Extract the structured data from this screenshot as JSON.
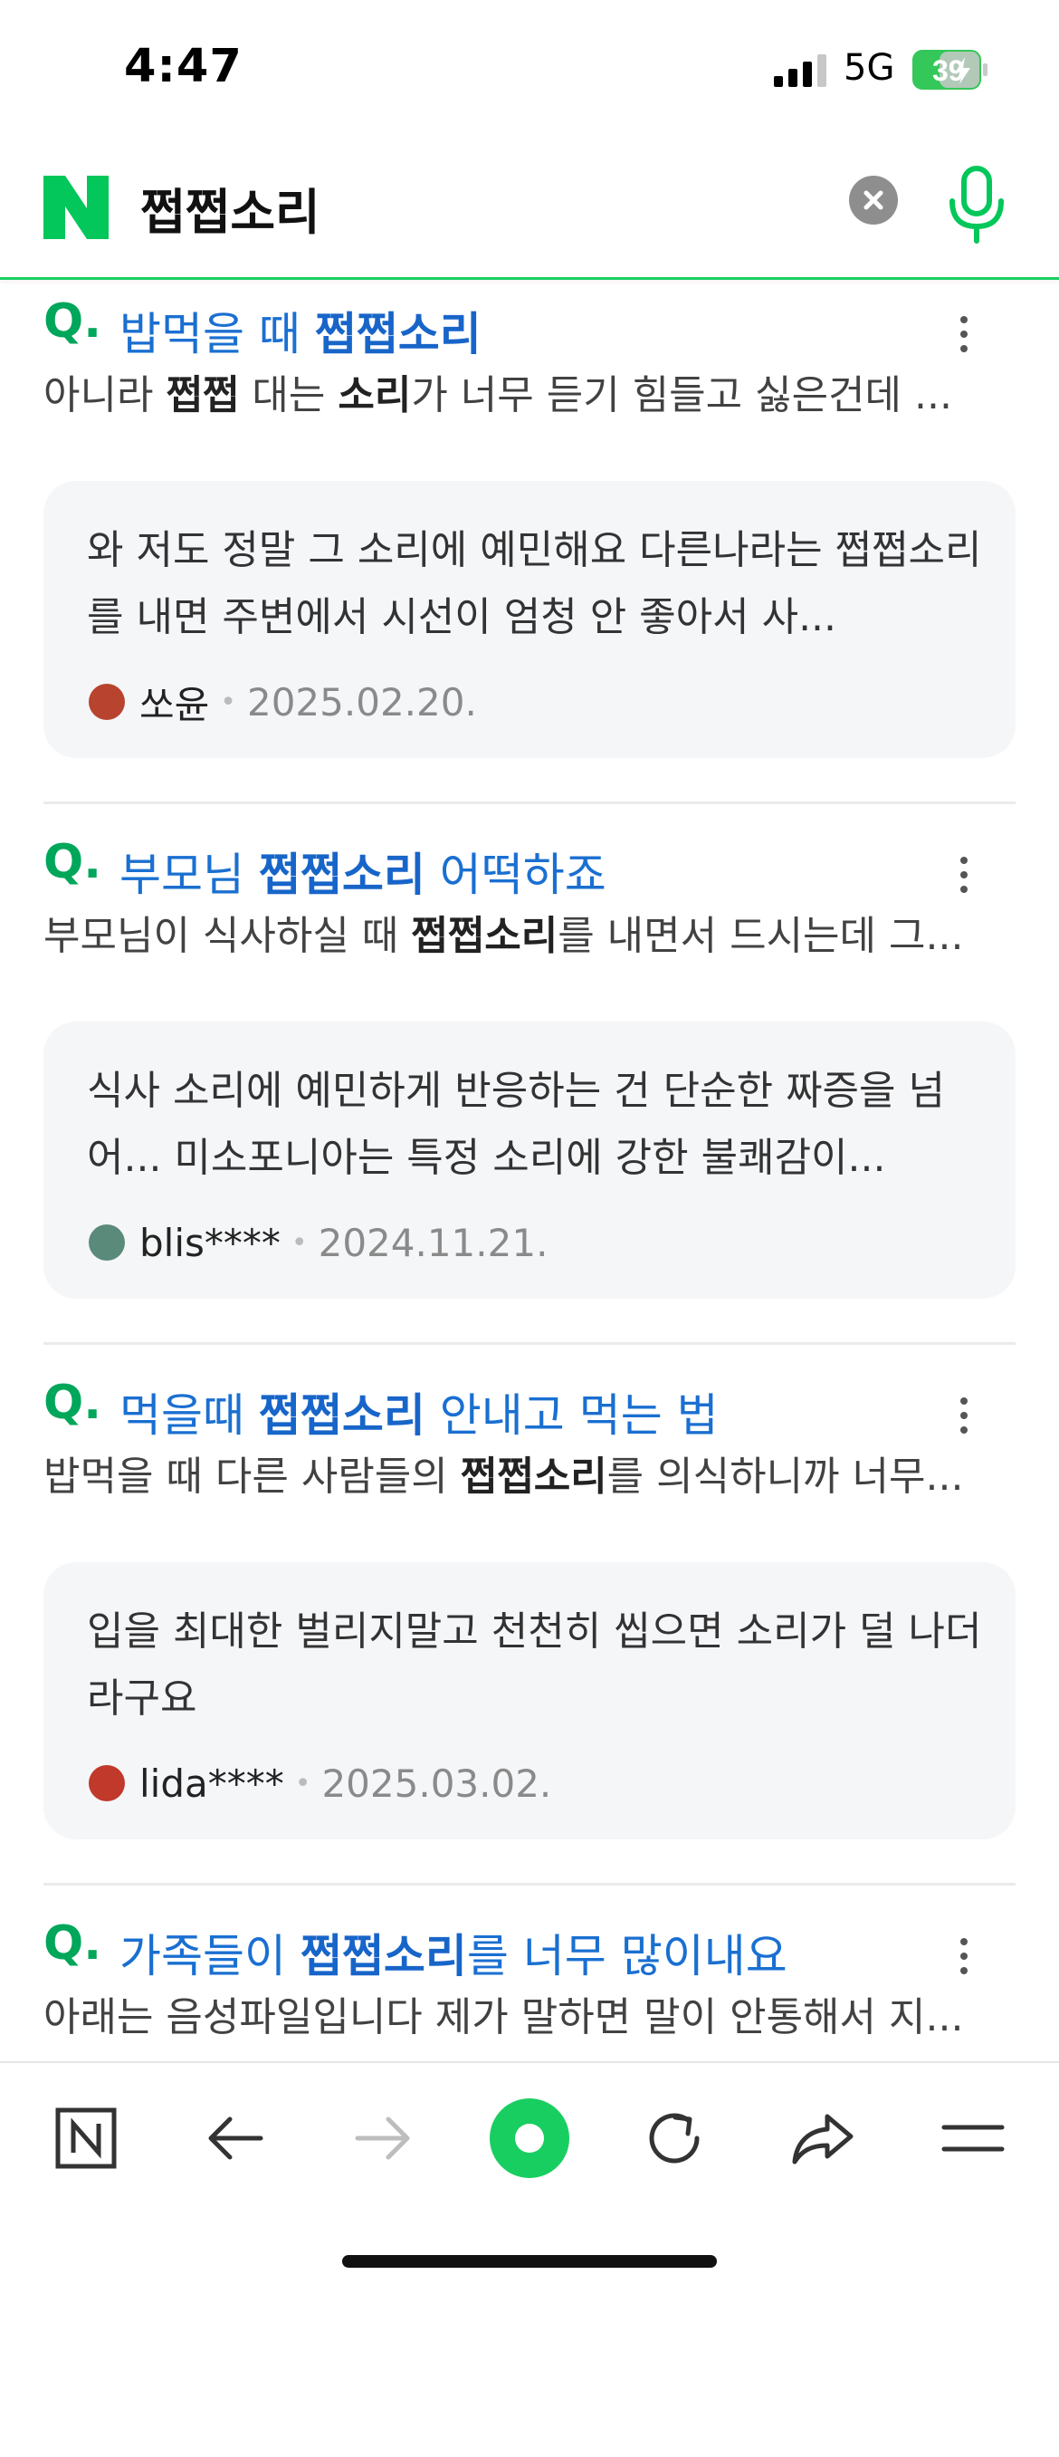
{
  "status_bar": {
    "time": "4:47",
    "network": "5G",
    "battery": "39"
  },
  "search": {
    "query": "쩝쩝소리"
  },
  "results": [
    {
      "title": [
        {
          "t": "밥먹을 때 ",
          "b": false
        },
        {
          "t": "쩝쩝소리",
          "b": true
        }
      ],
      "snippet": [
        {
          "t": "아니라 ",
          "b": false
        },
        {
          "t": "쩝쩝",
          "b": true
        },
        {
          "t": " 대는 ",
          "b": false
        },
        {
          "t": "소리",
          "b": true
        },
        {
          "t": "가 너무 듣기 힘들고 싫은건데 ...",
          "b": false
        }
      ],
      "answer": "와 저도 정말 그 소리에 예민해요 다른나라는 쩝쩝소리를 내면 주변에서 시선이 엄청 안 좋아서 사...",
      "author": "쏘윤",
      "date": "2025.02.20.",
      "avatar_color": "#b8432f"
    },
    {
      "title": [
        {
          "t": "부모님 ",
          "b": false
        },
        {
          "t": "쩝쩝소리",
          "b": true
        },
        {
          "t": " 어떡하죠",
          "b": false
        }
      ],
      "snippet": [
        {
          "t": "부모님이 식사하실 때 ",
          "b": false
        },
        {
          "t": "쩝쩝소리",
          "b": true
        },
        {
          "t": "를 내면서 드시는데 그...",
          "b": false
        }
      ],
      "answer": "식사 소리에 예민하게 반응하는 건 단순한 짜증을 넘어... 미소포니아는 특정 소리에 강한 불쾌감이...",
      "author": "blis****",
      "date": "2024.11.21.",
      "avatar_color": "#5a8a7a"
    },
    {
      "title": [
        {
          "t": "먹을때 ",
          "b": false
        },
        {
          "t": "쩝쩝소리",
          "b": true
        },
        {
          "t": " 안내고 먹는 법",
          "b": false
        }
      ],
      "snippet": [
        {
          "t": "밥먹을 때 다른 사람들의 ",
          "b": false
        },
        {
          "t": "쩝쩝소리",
          "b": true
        },
        {
          "t": "를 의식하니까 너무...",
          "b": false
        }
      ],
      "answer": "입을 최대한 벌리지말고 천천히 씹으면 소리가 덜 나더라구요",
      "author": "lida****",
      "date": "2025.03.02.",
      "avatar_color": "#c0392b"
    },
    {
      "title": [
        {
          "t": "가족들이 ",
          "b": false
        },
        {
          "t": "쩝쩝소리",
          "b": true
        },
        {
          "t": "를 너무 많이내요",
          "b": false
        }
      ],
      "snippet": [
        {
          "t": "아래는 음성파일입니다 제가 말하면 말이 안통해서 지...",
          "b": false
        }
      ],
      "answer": "",
      "author": "",
      "date": "",
      "avatar_color": "#888888"
    }
  ],
  "colors": {
    "naver_green": "#03c75a",
    "link_blue": "#1a6fd1"
  }
}
